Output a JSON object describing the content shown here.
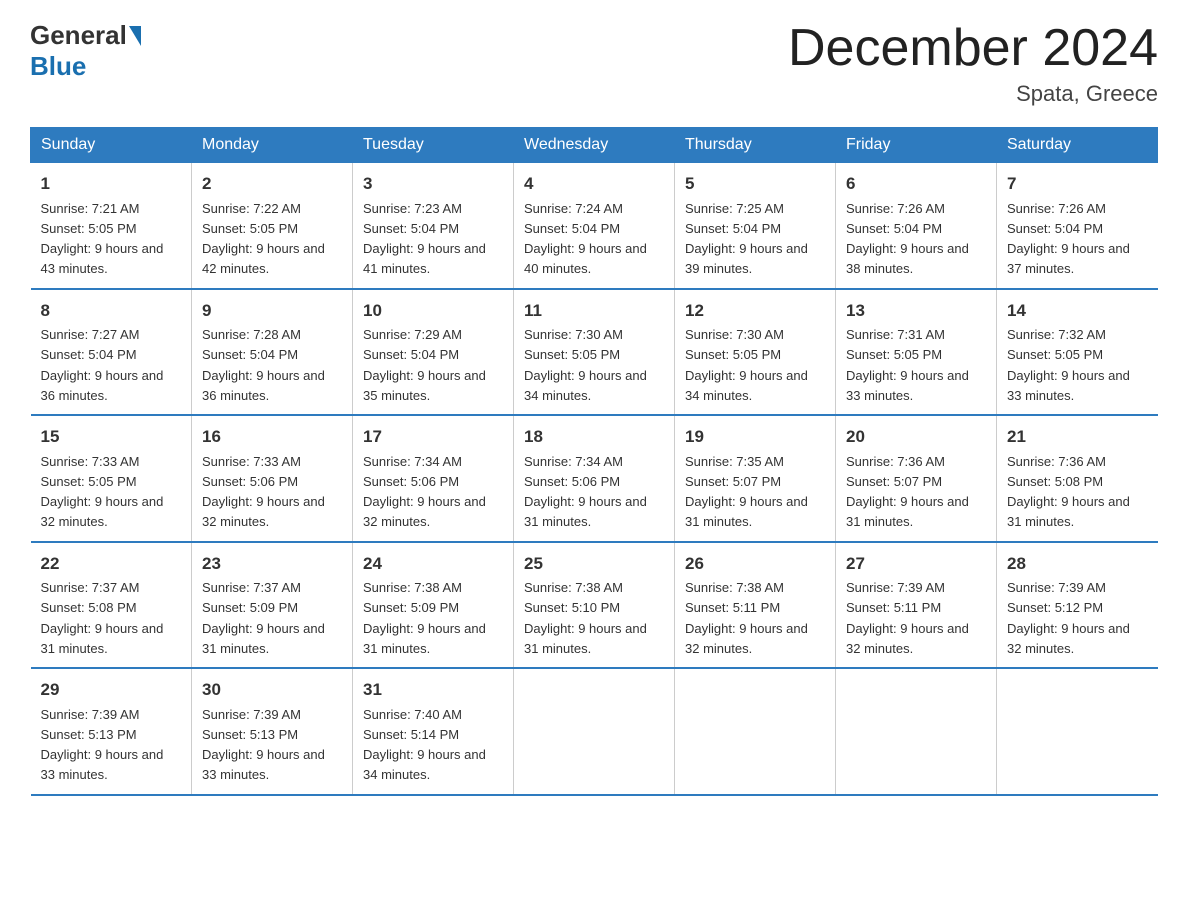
{
  "header": {
    "logo_general": "General",
    "logo_blue": "Blue",
    "month_title": "December 2024",
    "location": "Spata, Greece"
  },
  "weekdays": [
    "Sunday",
    "Monday",
    "Tuesday",
    "Wednesday",
    "Thursday",
    "Friday",
    "Saturday"
  ],
  "weeks": [
    [
      {
        "day": "1",
        "sunrise": "Sunrise: 7:21 AM",
        "sunset": "Sunset: 5:05 PM",
        "daylight": "Daylight: 9 hours and 43 minutes."
      },
      {
        "day": "2",
        "sunrise": "Sunrise: 7:22 AM",
        "sunset": "Sunset: 5:05 PM",
        "daylight": "Daylight: 9 hours and 42 minutes."
      },
      {
        "day": "3",
        "sunrise": "Sunrise: 7:23 AM",
        "sunset": "Sunset: 5:04 PM",
        "daylight": "Daylight: 9 hours and 41 minutes."
      },
      {
        "day": "4",
        "sunrise": "Sunrise: 7:24 AM",
        "sunset": "Sunset: 5:04 PM",
        "daylight": "Daylight: 9 hours and 40 minutes."
      },
      {
        "day": "5",
        "sunrise": "Sunrise: 7:25 AM",
        "sunset": "Sunset: 5:04 PM",
        "daylight": "Daylight: 9 hours and 39 minutes."
      },
      {
        "day": "6",
        "sunrise": "Sunrise: 7:26 AM",
        "sunset": "Sunset: 5:04 PM",
        "daylight": "Daylight: 9 hours and 38 minutes."
      },
      {
        "day": "7",
        "sunrise": "Sunrise: 7:26 AM",
        "sunset": "Sunset: 5:04 PM",
        "daylight": "Daylight: 9 hours and 37 minutes."
      }
    ],
    [
      {
        "day": "8",
        "sunrise": "Sunrise: 7:27 AM",
        "sunset": "Sunset: 5:04 PM",
        "daylight": "Daylight: 9 hours and 36 minutes."
      },
      {
        "day": "9",
        "sunrise": "Sunrise: 7:28 AM",
        "sunset": "Sunset: 5:04 PM",
        "daylight": "Daylight: 9 hours and 36 minutes."
      },
      {
        "day": "10",
        "sunrise": "Sunrise: 7:29 AM",
        "sunset": "Sunset: 5:04 PM",
        "daylight": "Daylight: 9 hours and 35 minutes."
      },
      {
        "day": "11",
        "sunrise": "Sunrise: 7:30 AM",
        "sunset": "Sunset: 5:05 PM",
        "daylight": "Daylight: 9 hours and 34 minutes."
      },
      {
        "day": "12",
        "sunrise": "Sunrise: 7:30 AM",
        "sunset": "Sunset: 5:05 PM",
        "daylight": "Daylight: 9 hours and 34 minutes."
      },
      {
        "day": "13",
        "sunrise": "Sunrise: 7:31 AM",
        "sunset": "Sunset: 5:05 PM",
        "daylight": "Daylight: 9 hours and 33 minutes."
      },
      {
        "day": "14",
        "sunrise": "Sunrise: 7:32 AM",
        "sunset": "Sunset: 5:05 PM",
        "daylight": "Daylight: 9 hours and 33 minutes."
      }
    ],
    [
      {
        "day": "15",
        "sunrise": "Sunrise: 7:33 AM",
        "sunset": "Sunset: 5:05 PM",
        "daylight": "Daylight: 9 hours and 32 minutes."
      },
      {
        "day": "16",
        "sunrise": "Sunrise: 7:33 AM",
        "sunset": "Sunset: 5:06 PM",
        "daylight": "Daylight: 9 hours and 32 minutes."
      },
      {
        "day": "17",
        "sunrise": "Sunrise: 7:34 AM",
        "sunset": "Sunset: 5:06 PM",
        "daylight": "Daylight: 9 hours and 32 minutes."
      },
      {
        "day": "18",
        "sunrise": "Sunrise: 7:34 AM",
        "sunset": "Sunset: 5:06 PM",
        "daylight": "Daylight: 9 hours and 31 minutes."
      },
      {
        "day": "19",
        "sunrise": "Sunrise: 7:35 AM",
        "sunset": "Sunset: 5:07 PM",
        "daylight": "Daylight: 9 hours and 31 minutes."
      },
      {
        "day": "20",
        "sunrise": "Sunrise: 7:36 AM",
        "sunset": "Sunset: 5:07 PM",
        "daylight": "Daylight: 9 hours and 31 minutes."
      },
      {
        "day": "21",
        "sunrise": "Sunrise: 7:36 AM",
        "sunset": "Sunset: 5:08 PM",
        "daylight": "Daylight: 9 hours and 31 minutes."
      }
    ],
    [
      {
        "day": "22",
        "sunrise": "Sunrise: 7:37 AM",
        "sunset": "Sunset: 5:08 PM",
        "daylight": "Daylight: 9 hours and 31 minutes."
      },
      {
        "day": "23",
        "sunrise": "Sunrise: 7:37 AM",
        "sunset": "Sunset: 5:09 PM",
        "daylight": "Daylight: 9 hours and 31 minutes."
      },
      {
        "day": "24",
        "sunrise": "Sunrise: 7:38 AM",
        "sunset": "Sunset: 5:09 PM",
        "daylight": "Daylight: 9 hours and 31 minutes."
      },
      {
        "day": "25",
        "sunrise": "Sunrise: 7:38 AM",
        "sunset": "Sunset: 5:10 PM",
        "daylight": "Daylight: 9 hours and 31 minutes."
      },
      {
        "day": "26",
        "sunrise": "Sunrise: 7:38 AM",
        "sunset": "Sunset: 5:11 PM",
        "daylight": "Daylight: 9 hours and 32 minutes."
      },
      {
        "day": "27",
        "sunrise": "Sunrise: 7:39 AM",
        "sunset": "Sunset: 5:11 PM",
        "daylight": "Daylight: 9 hours and 32 minutes."
      },
      {
        "day": "28",
        "sunrise": "Sunrise: 7:39 AM",
        "sunset": "Sunset: 5:12 PM",
        "daylight": "Daylight: 9 hours and 32 minutes."
      }
    ],
    [
      {
        "day": "29",
        "sunrise": "Sunrise: 7:39 AM",
        "sunset": "Sunset: 5:13 PM",
        "daylight": "Daylight: 9 hours and 33 minutes."
      },
      {
        "day": "30",
        "sunrise": "Sunrise: 7:39 AM",
        "sunset": "Sunset: 5:13 PM",
        "daylight": "Daylight: 9 hours and 33 minutes."
      },
      {
        "day": "31",
        "sunrise": "Sunrise: 7:40 AM",
        "sunset": "Sunset: 5:14 PM",
        "daylight": "Daylight: 9 hours and 34 minutes."
      },
      {
        "day": "",
        "sunrise": "",
        "sunset": "",
        "daylight": ""
      },
      {
        "day": "",
        "sunrise": "",
        "sunset": "",
        "daylight": ""
      },
      {
        "day": "",
        "sunrise": "",
        "sunset": "",
        "daylight": ""
      },
      {
        "day": "",
        "sunrise": "",
        "sunset": "",
        "daylight": ""
      }
    ]
  ]
}
